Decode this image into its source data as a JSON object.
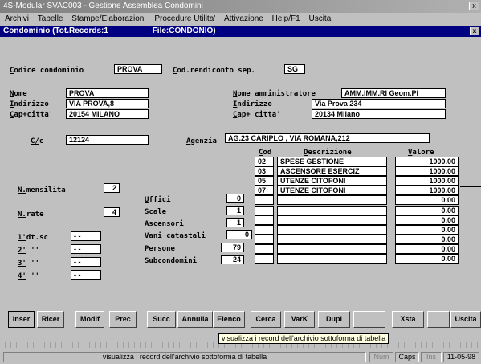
{
  "window": {
    "title": "4S-Modular SVAC003 - Gestione Assemblea Condomini",
    "close": "x"
  },
  "menu": [
    "Archivi",
    "Tabelle",
    "Stampe/Elaborazioni",
    "Procedure Utilita'",
    "Attivazione",
    "Help/F1",
    "Uscita"
  ],
  "inner": {
    "title": "Condominio (Tot.Records:1",
    "file": "File:CONDONIO)",
    "close": "x"
  },
  "form": {
    "codice_label": "Codice condominio",
    "codice_value": "PROVA",
    "cod_rend_label": "Cod.rendiconto sep.",
    "cod_rend_value": "SG",
    "nome_label": "Nome",
    "nome_value": "PROVA",
    "indirizzo_label": "Indirizzo",
    "indirizzo_value": "VIA PROVA,8",
    "cap_label": "Cap+citta'",
    "cap_value": "20154 MILANO",
    "nome_amm_label": "Nome amministratore",
    "nome_amm_value": "AMM.IMM.RI Geom.Pl",
    "ind_amm_label": "Indirizzo",
    "ind_amm_value": "Via Prova 234",
    "cap_amm_label": "Cap+ citta'",
    "cap_amm_value": "20134 Milano",
    "cc_label": "C/c",
    "cc_value": "12124",
    "agenzia_label": "Agenzia",
    "agenzia_value": "AG.23 CARIPLO , VIA ROMANA,212",
    "col_cod": "Cod",
    "col_desc": "Descrizione",
    "col_val": "Valore",
    "mensilita_label": "N.mensilita",
    "mensilita_value": "2",
    "rate_label": "N.rate",
    "rate_value": "4",
    "dtsc1_label": "1'dt.sc",
    "dtsc_value": "- -",
    "dtsc2_label": "2' ''",
    "dtsc3_label": "3' ''",
    "dtsc4_label": "4' ''",
    "uffici_label": "Uffici",
    "uffici_value": "0",
    "scale_label": "Scale",
    "scale_value": "1",
    "ascensori_label": "Ascensori",
    "ascensori_value": "1",
    "vani_label": "Vani catastali",
    "vani_value": "0",
    "persone_label": "Persone",
    "persone_value": "79",
    "subcond_label": "Subcondomini",
    "subcond_value": "24",
    "rows": [
      {
        "cod": "02",
        "desc": "SPESE GESTIONE",
        "val": "1000.00"
      },
      {
        "cod": "03",
        "desc": "ASCENSORE ESERCIZ",
        "val": "1000.00"
      },
      {
        "cod": "05",
        "desc": "UTENZE CITOFONI",
        "val": "1000.00"
      },
      {
        "cod": "07",
        "desc": "UTENZE CITOFONI",
        "val": "1000.00"
      },
      {
        "cod": "",
        "desc": "",
        "val": "0.00"
      },
      {
        "cod": "",
        "desc": "",
        "val": "0.00"
      },
      {
        "cod": "",
        "desc": "",
        "val": "0.00"
      },
      {
        "cod": "",
        "desc": "",
        "val": "0.00"
      },
      {
        "cod": "",
        "desc": "",
        "val": "0.00"
      },
      {
        "cod": "",
        "desc": "",
        "val": "0.00"
      },
      {
        "cod": "",
        "desc": "",
        "val": "0.00"
      }
    ]
  },
  "buttons": [
    "Inser",
    "Ricer",
    "Modif",
    "Prec",
    "Succ",
    "Annulla",
    "Elenco",
    "Cerca",
    "VarK",
    "Dupl",
    "",
    "Xsta",
    "",
    "Uscita"
  ],
  "tooltip": "visualizza i record dell'archivio sottoforma di tabella",
  "status": {
    "text": "visualizza i record dell'archivio sottoforma di tabella",
    "num": "Num",
    "caps": "Caps",
    "ins": "Ins",
    "date": "11-05-98"
  }
}
